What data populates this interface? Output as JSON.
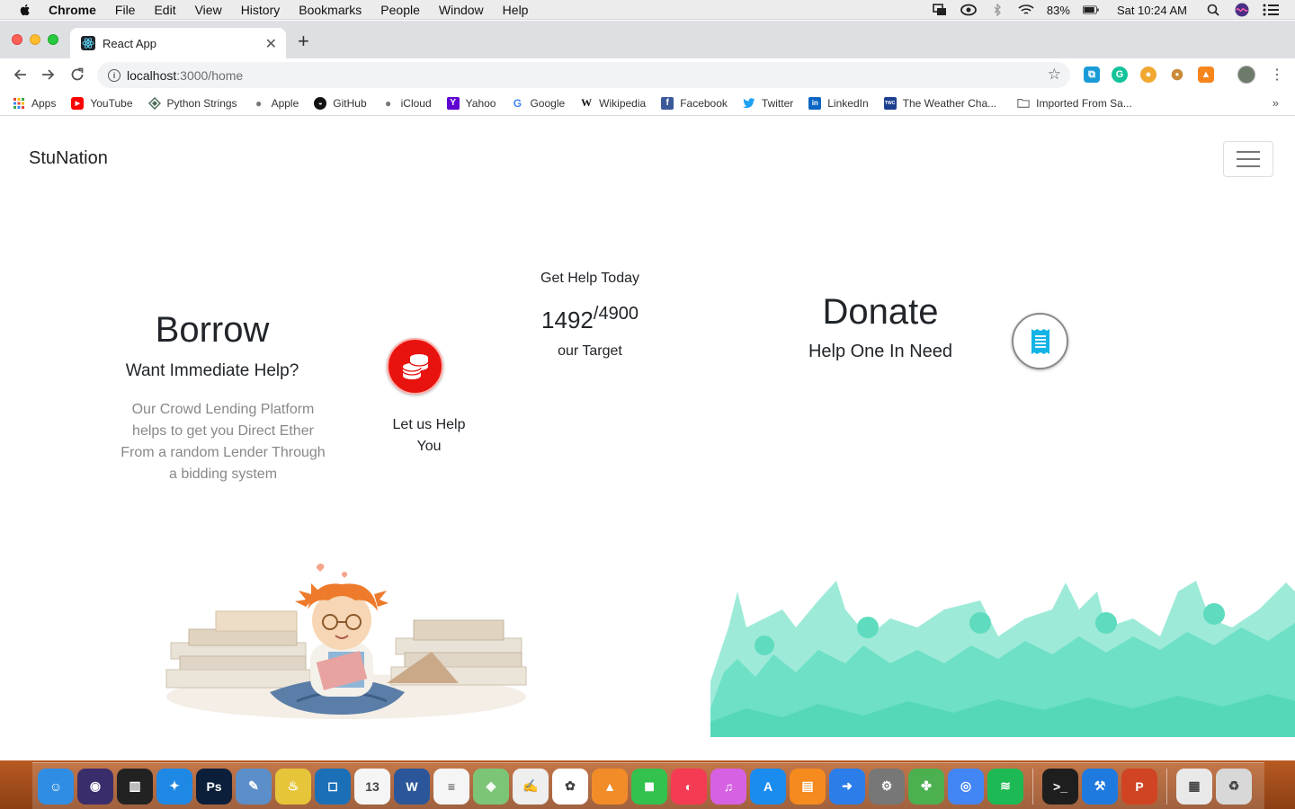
{
  "menubar": {
    "app_name": "Chrome",
    "items": [
      "File",
      "Edit",
      "View",
      "History",
      "Bookmarks",
      "People",
      "Window",
      "Help"
    ],
    "battery": "83%",
    "clock": "Sat 10:24 AM"
  },
  "browser": {
    "tab_title": "React App",
    "url_host": "localhost",
    "url_path": ":3000/home",
    "bookmarks": [
      {
        "label": "Apps",
        "icon": "apps-grid-icon",
        "color": "#e94235"
      },
      {
        "label": "YouTube",
        "icon": "youtube-icon",
        "color": "#ff0000"
      },
      {
        "label": "Python Strings",
        "icon": "python-strings-icon",
        "color": "#4a6b57"
      },
      {
        "label": "Apple",
        "icon": "apple-icon",
        "color": "#777777"
      },
      {
        "label": "GitHub",
        "icon": "github-icon",
        "color": "#111111"
      },
      {
        "label": "iCloud",
        "icon": "apple-icon",
        "color": "#777777"
      },
      {
        "label": "Yahoo",
        "icon": "yahoo-icon",
        "color": "#5f01d1"
      },
      {
        "label": "Google",
        "icon": "google-icon",
        "color": "#4285f4"
      },
      {
        "label": "Wikipedia",
        "icon": "wikipedia-icon",
        "color": "#111111"
      },
      {
        "label": "Facebook",
        "icon": "facebook-icon",
        "color": "#3b5998"
      },
      {
        "label": "Twitter",
        "icon": "twitter-icon",
        "color": "#1da1f2"
      },
      {
        "label": "LinkedIn",
        "icon": "linkedin-icon",
        "color": "#0a66c2"
      },
      {
        "label": "The Weather Cha...",
        "icon": "weather-channel-icon",
        "color": "#1d3f8f"
      },
      {
        "label": "Imported From Sa...",
        "icon": "folder-icon",
        "color": "#666666"
      }
    ]
  },
  "site": {
    "brand": "StuNation",
    "borrow": {
      "title": "Borrow",
      "subtitle": "Want Immediate Help?",
      "description": "Our Crowd Lending Platform helps to get you Direct Ether From a random Lender Through a bidding system",
      "cta": "Let us Help You"
    },
    "get_help": {
      "title": "Get Help Today",
      "raised": "1492",
      "target": "/4900",
      "target_label": "our Target"
    },
    "donate": {
      "title": "Donate",
      "subtitle": "Help One In Need"
    },
    "colors": {
      "coin_button": "#e8130f",
      "receipt_icon": "#13b3e6",
      "crowd": "#6ee0c5"
    }
  },
  "dock": {
    "apps": [
      {
        "name": "finder-icon",
        "color": "#2f8de4",
        "glyph": "☺"
      },
      {
        "name": "siri-icon",
        "color": "#3a2d6b",
        "glyph": "◉"
      },
      {
        "name": "piano-icon",
        "color": "#222222",
        "glyph": "▥"
      },
      {
        "name": "safari-icon",
        "color": "#1e88e5",
        "glyph": "✦"
      },
      {
        "name": "photoshop-icon",
        "color": "#0b1f3a",
        "glyph": "Ps"
      },
      {
        "name": "preview-icon",
        "color": "#5c8fc9",
        "glyph": "✎"
      },
      {
        "name": "genie-icon",
        "color": "#e7c53a",
        "glyph": "♨"
      },
      {
        "name": "bracket-icon",
        "color": "#1a6fb7",
        "glyph": "◻"
      },
      {
        "name": "calendar-icon",
        "color": "#f5f5f5",
        "glyph": "13"
      },
      {
        "name": "word-icon",
        "color": "#2b579a",
        "glyph": "W"
      },
      {
        "name": "reminders-icon",
        "color": "#f5f5f5",
        "glyph": "≡"
      },
      {
        "name": "maps-icon",
        "color": "#7cc576",
        "glyph": "◈"
      },
      {
        "name": "textedit-icon",
        "color": "#eeeeee",
        "glyph": "✍"
      },
      {
        "name": "photos-icon",
        "color": "#ffffff",
        "glyph": "✿"
      },
      {
        "name": "vlc-icon",
        "color": "#f28c28",
        "glyph": "▲"
      },
      {
        "name": "facetime-icon",
        "color": "#32c24d",
        "glyph": "◼"
      },
      {
        "name": "news-icon",
        "color": "#f43b53",
        "glyph": "◐"
      },
      {
        "name": "itunes-icon",
        "color": "#d761e3",
        "glyph": "♫"
      },
      {
        "name": "app-store-icon",
        "color": "#1a8cf0",
        "glyph": "A"
      },
      {
        "name": "books-icon",
        "color": "#f58a1f",
        "glyph": "▤"
      },
      {
        "name": "migration-icon",
        "color": "#2b7de9",
        "glyph": "➜"
      },
      {
        "name": "system-preferences-icon",
        "color": "#777777",
        "glyph": "⚙"
      },
      {
        "name": "clover-icon",
        "color": "#4caf50",
        "glyph": "✤"
      },
      {
        "name": "chrome-icon",
        "color": "#4285f4",
        "glyph": "◎"
      },
      {
        "name": "spotify-icon",
        "color": "#1db954",
        "glyph": "≋"
      },
      {
        "name": "terminal-icon",
        "color": "#1e1e1e",
        "glyph": ">_"
      },
      {
        "name": "xcode-icon",
        "color": "#1f7ae0",
        "glyph": "⚒"
      },
      {
        "name": "powerpoint-icon",
        "color": "#d04423",
        "glyph": "P"
      },
      {
        "name": "downloads-icon",
        "color": "#e9e9e9",
        "glyph": "▦"
      },
      {
        "name": "trash-icon",
        "color": "#d8d8d8",
        "glyph": "♻"
      }
    ]
  }
}
